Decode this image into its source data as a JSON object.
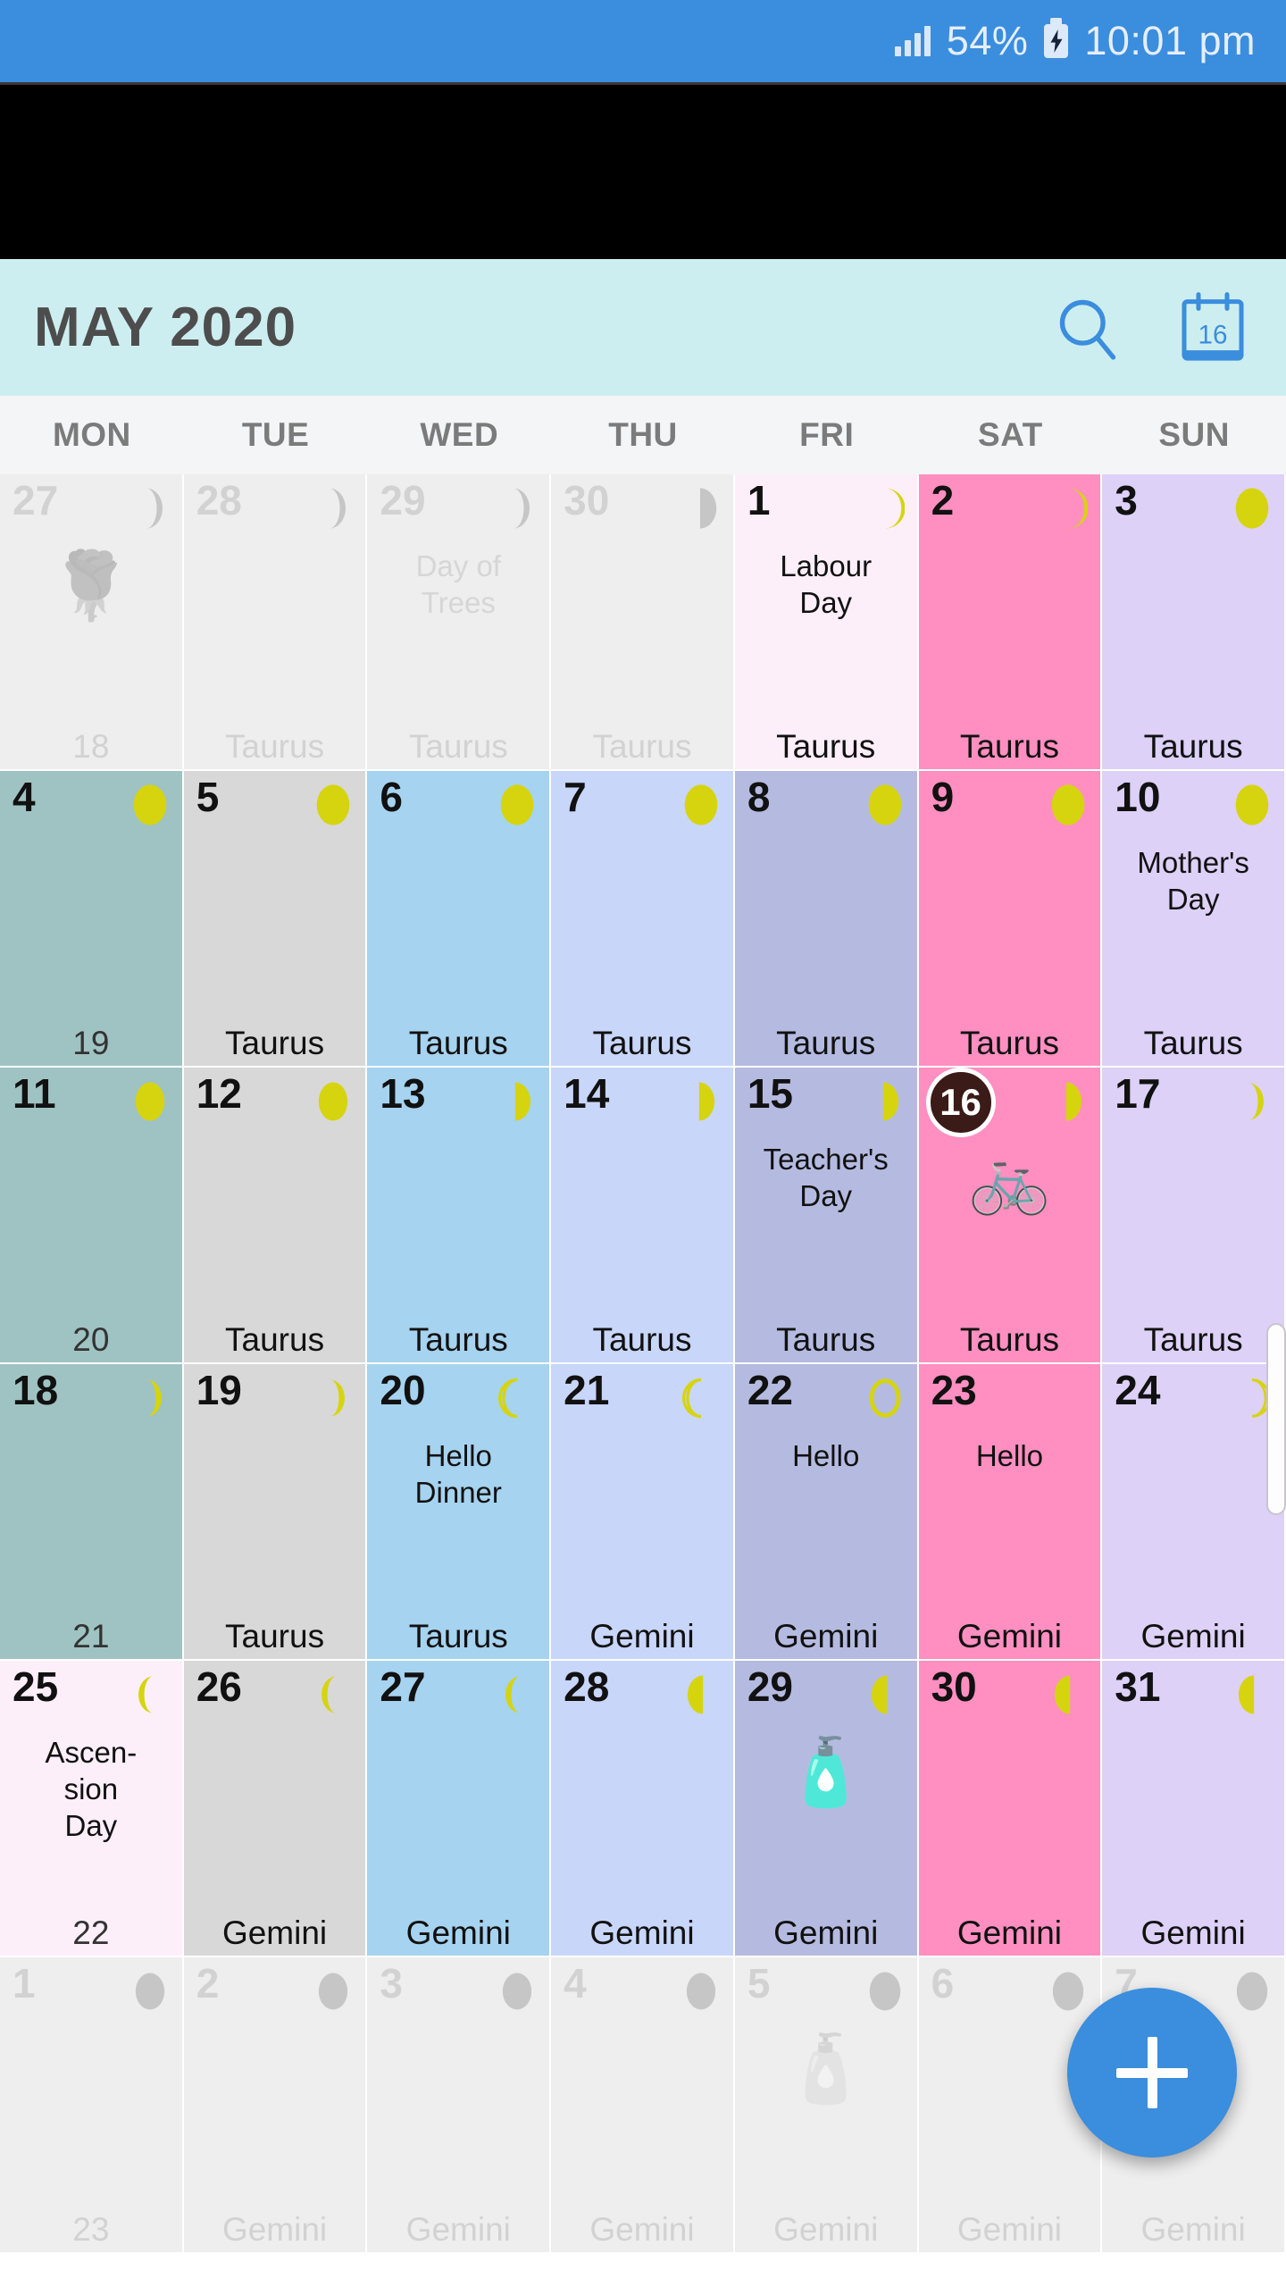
{
  "status_bar": {
    "battery_percent": "54%",
    "time": "10:01 pm",
    "signal_icon": "signal-bars-icon",
    "battery_icon": "battery-charging-icon"
  },
  "app_bar": {
    "title": "MAY 2020",
    "search_icon": "search-icon",
    "today_icon": "calendar-today-icon",
    "today_icon_label": "16"
  },
  "weekday_headers": [
    "MON",
    "TUE",
    "WED",
    "THU",
    "FRI",
    "SAT",
    "SUN"
  ],
  "colors": {
    "status_bar": "#3b8ddd",
    "app_bar": "#cdeef0",
    "weekday_bar": "#f4f5f6",
    "monday": "#9fc3c2",
    "tuesday": "#d8d8d8",
    "wednesday": "#a6d3ef",
    "thursday": "#c8d6f9",
    "friday": "#b5bbe0",
    "saturday": "#ff8fc0",
    "sunday": "#ddd1f7",
    "holiday": "#fdeffa",
    "out_of_month": "#eeeeee",
    "selected_day": "#3b1b17",
    "moon": "#d6d40f",
    "moon_out": "#c6c6c6",
    "fab": "#3b8ddd"
  },
  "fab": {
    "label": "+",
    "name": "add-event-button"
  },
  "weeks": [
    {
      "days": [
        {
          "num": "27",
          "out": true,
          "bg": "#eeeeee",
          "moon": "waning-crescent",
          "events": [],
          "emoji": "🌹",
          "footer": "18",
          "footer_is_week": true
        },
        {
          "num": "28",
          "out": true,
          "bg": "#eeeeee",
          "moon": "waning-crescent",
          "events": [],
          "emoji": "",
          "footer": "Taurus",
          "footer_is_week": false
        },
        {
          "num": "29",
          "out": true,
          "bg": "#eeeeee",
          "moon": "waning-crescent",
          "events": [
            "Day of",
            "Trees"
          ],
          "emoji": "",
          "footer": "Taurus",
          "footer_is_week": false
        },
        {
          "num": "30",
          "out": true,
          "bg": "#eeeeee",
          "moon": "last-quarter",
          "events": [],
          "emoji": "",
          "footer": "Taurus",
          "footer_is_week": false
        },
        {
          "num": "1",
          "out": false,
          "bg": "#fdeffa",
          "moon": "waning-gibbous",
          "events": [
            "Labour",
            "Day"
          ],
          "emoji": "",
          "footer": "Taurus",
          "footer_is_week": false
        },
        {
          "num": "2",
          "out": false,
          "bg": "#ff8fc0",
          "moon": "waning-gibbous",
          "events": [],
          "emoji": "",
          "footer": "Taurus",
          "footer_is_week": false
        },
        {
          "num": "3",
          "out": false,
          "bg": "#ddd1f7",
          "moon": "full",
          "events": [],
          "emoji": "",
          "footer": "Taurus",
          "footer_is_week": false
        }
      ]
    },
    {
      "days": [
        {
          "num": "4",
          "out": false,
          "bg": "#9fc3c2",
          "moon": "full",
          "events": [],
          "emoji": "",
          "footer": "19",
          "footer_is_week": true
        },
        {
          "num": "5",
          "out": false,
          "bg": "#d8d8d8",
          "moon": "full",
          "events": [],
          "emoji": "",
          "footer": "Taurus",
          "footer_is_week": false
        },
        {
          "num": "6",
          "out": false,
          "bg": "#a6d3ef",
          "moon": "full",
          "events": [],
          "emoji": "",
          "footer": "Taurus",
          "footer_is_week": false
        },
        {
          "num": "7",
          "out": false,
          "bg": "#c8d6f9",
          "moon": "full",
          "events": [],
          "emoji": "",
          "footer": "Taurus",
          "footer_is_week": false
        },
        {
          "num": "8",
          "out": false,
          "bg": "#b5bbe0",
          "moon": "full",
          "events": [],
          "emoji": "",
          "footer": "Taurus",
          "footer_is_week": false
        },
        {
          "num": "9",
          "out": false,
          "bg": "#ff8fc0",
          "moon": "full",
          "events": [],
          "emoji": "",
          "footer": "Taurus",
          "footer_is_week": false
        },
        {
          "num": "10",
          "out": false,
          "bg": "#ddd1f7",
          "moon": "full",
          "events": [
            "Mother's",
            "Day"
          ],
          "emoji": "",
          "footer": "Taurus",
          "footer_is_week": false
        }
      ]
    },
    {
      "days": [
        {
          "num": "11",
          "out": false,
          "bg": "#9fc3c2",
          "moon": "waning-gibbous-sm",
          "events": [],
          "emoji": "",
          "footer": "20",
          "footer_is_week": true
        },
        {
          "num": "12",
          "out": false,
          "bg": "#d8d8d8",
          "moon": "waning-gibbous-sm",
          "events": [],
          "emoji": "",
          "footer": "Taurus",
          "footer_is_week": false
        },
        {
          "num": "13",
          "out": false,
          "bg": "#a6d3ef",
          "moon": "last-quarter-y",
          "events": [],
          "emoji": "",
          "footer": "Taurus",
          "footer_is_week": false
        },
        {
          "num": "14",
          "out": false,
          "bg": "#c8d6f9",
          "moon": "last-quarter-y",
          "events": [],
          "emoji": "",
          "footer": "Taurus",
          "footer_is_week": false
        },
        {
          "num": "15",
          "out": false,
          "bg": "#b5bbe0",
          "moon": "last-quarter-y",
          "events": [
            "Teacher's",
            "Day"
          ],
          "emoji": "",
          "footer": "Taurus",
          "footer_is_week": false
        },
        {
          "num": "16",
          "out": false,
          "bg": "#ff8fc0",
          "moon": "last-quarter-y",
          "events": [],
          "emoji": "🚲",
          "footer": "Taurus",
          "footer_is_week": false,
          "selected": true
        },
        {
          "num": "17",
          "out": false,
          "bg": "#ddd1f7",
          "moon": "waning-crescent-y",
          "events": [],
          "emoji": "",
          "footer": "Taurus",
          "footer_is_week": false
        }
      ]
    },
    {
      "days": [
        {
          "num": "18",
          "out": false,
          "bg": "#9fc3c2",
          "moon": "waning-crescent-y",
          "events": [],
          "emoji": "",
          "footer": "21",
          "footer_is_week": true
        },
        {
          "num": "19",
          "out": false,
          "bg": "#d8d8d8",
          "moon": "waning-crescent-y",
          "events": [],
          "emoji": "",
          "footer": "Taurus",
          "footer_is_week": false
        },
        {
          "num": "20",
          "out": false,
          "bg": "#a6d3ef",
          "moon": "waning-crescent-thin",
          "events": [
            "Hello",
            "Dinner"
          ],
          "emoji": "",
          "footer": "Taurus",
          "footer_is_week": false
        },
        {
          "num": "21",
          "out": false,
          "bg": "#c8d6f9",
          "moon": "waning-crescent-thin",
          "events": [],
          "emoji": "",
          "footer": "Gemini",
          "footer_is_week": false
        },
        {
          "num": "22",
          "out": false,
          "bg": "#b5bbe0",
          "moon": "new",
          "events": [
            "Hello"
          ],
          "emoji": "",
          "footer": "Gemini",
          "footer_is_week": false
        },
        {
          "num": "23",
          "out": false,
          "bg": "#ff8fc0",
          "moon": "none",
          "events": [
            "Hello"
          ],
          "emoji": "",
          "footer": "Gemini",
          "footer_is_week": false
        },
        {
          "num": "24",
          "out": false,
          "bg": "#ddd1f7",
          "moon": "waxing-crescent-thin",
          "events": [],
          "emoji": "",
          "footer": "Gemini",
          "footer_is_week": false
        }
      ]
    },
    {
      "days": [
        {
          "num": "25",
          "out": false,
          "bg": "#fdeffa",
          "moon": "waxing-crescent-y",
          "events": [
            "Ascen-",
            "sion",
            "Day"
          ],
          "emoji": "",
          "footer": "22",
          "footer_is_week": true
        },
        {
          "num": "26",
          "out": false,
          "bg": "#d8d8d8",
          "moon": "waxing-crescent-y",
          "events": [],
          "emoji": "",
          "footer": "Gemini",
          "footer_is_week": false
        },
        {
          "num": "27",
          "out": false,
          "bg": "#a6d3ef",
          "moon": "waxing-crescent-y",
          "events": [],
          "emoji": "",
          "footer": "Gemini",
          "footer_is_week": false
        },
        {
          "num": "28",
          "out": false,
          "bg": "#c8d6f9",
          "moon": "first-quarter-y",
          "events": [],
          "emoji": "",
          "footer": "Gemini",
          "footer_is_week": false
        },
        {
          "num": "29",
          "out": false,
          "bg": "#b5bbe0",
          "moon": "first-quarter-y",
          "events": [],
          "emoji": "🧴",
          "footer": "Gemini",
          "footer_is_week": false
        },
        {
          "num": "30",
          "out": false,
          "bg": "#ff8fc0",
          "moon": "first-quarter-y",
          "events": [],
          "emoji": "",
          "footer": "Gemini",
          "footer_is_week": false
        },
        {
          "num": "31",
          "out": false,
          "bg": "#ddd1f7",
          "moon": "first-quarter-y",
          "events": [],
          "emoji": "",
          "footer": "Gemini",
          "footer_is_week": false
        }
      ]
    },
    {
      "days": [
        {
          "num": "1",
          "out": true,
          "bg": "#eeeeee",
          "moon": "waxing-gibbous-g",
          "events": [],
          "emoji": "",
          "footer": "23",
          "footer_is_week": true
        },
        {
          "num": "2",
          "out": true,
          "bg": "#eeeeee",
          "moon": "waxing-gibbous-g",
          "events": [],
          "emoji": "",
          "footer": "Gemini",
          "footer_is_week": false
        },
        {
          "num": "3",
          "out": true,
          "bg": "#eeeeee",
          "moon": "waxing-gibbous-g",
          "events": [],
          "emoji": "",
          "footer": "Gemini",
          "footer_is_week": false
        },
        {
          "num": "4",
          "out": true,
          "bg": "#eeeeee",
          "moon": "waxing-gibbous-g",
          "events": [],
          "emoji": "",
          "footer": "Gemini",
          "footer_is_week": false
        },
        {
          "num": "5",
          "out": true,
          "bg": "#eeeeee",
          "moon": "full-g",
          "events": [],
          "emoji": "🧴",
          "footer": "Gemini",
          "footer_is_week": false
        },
        {
          "num": "6",
          "out": true,
          "bg": "#eeeeee",
          "moon": "full-g",
          "events": [],
          "emoji": "",
          "footer": "Gemini",
          "footer_is_week": false
        },
        {
          "num": "7",
          "out": true,
          "bg": "#eeeeee",
          "moon": "full-g",
          "events": [],
          "emoji": "",
          "footer": "Gemini",
          "footer_is_week": false
        }
      ]
    }
  ]
}
